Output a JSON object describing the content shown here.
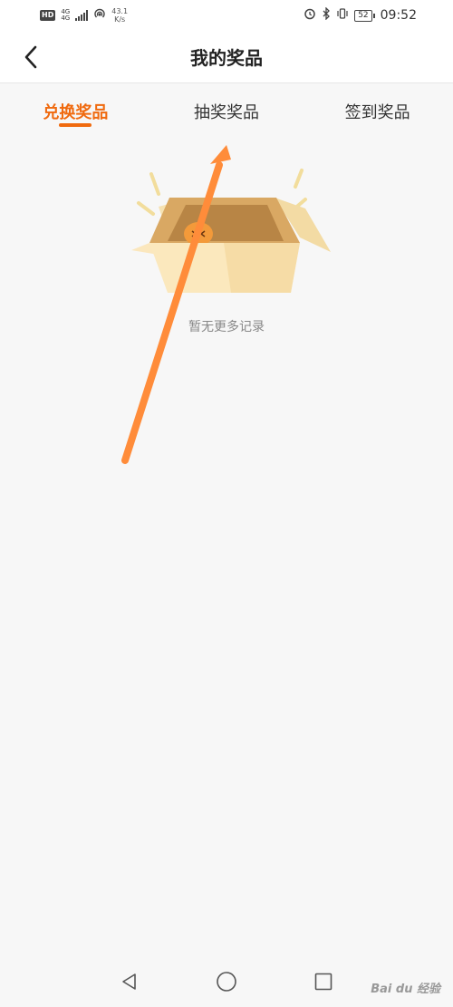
{
  "status_bar": {
    "hd": "HD",
    "network_top": "4G",
    "network_bottom": "4G",
    "speed_value": "43.1",
    "speed_unit": "K/s",
    "battery": "52",
    "time": "09:52"
  },
  "header": {
    "title": "我的奖品",
    "back_icon": "chevron-left-icon"
  },
  "tabs": [
    {
      "label": "兑换奖品",
      "active": true
    },
    {
      "label": "抽奖奖品",
      "active": false
    },
    {
      "label": "签到奖品",
      "active": false
    }
  ],
  "empty_state": {
    "message": "暂无更多记录",
    "illustration": "open-box-icon"
  },
  "colors": {
    "accent": "#f06a0f",
    "arrow": "#ff8c3a",
    "background": "#f7f7f7"
  },
  "nav_bar": {
    "back_icon": "triangle-back-icon",
    "home_icon": "circle-home-icon",
    "recents_icon": "square-recents-icon"
  },
  "watermark": "Bai du 经验"
}
